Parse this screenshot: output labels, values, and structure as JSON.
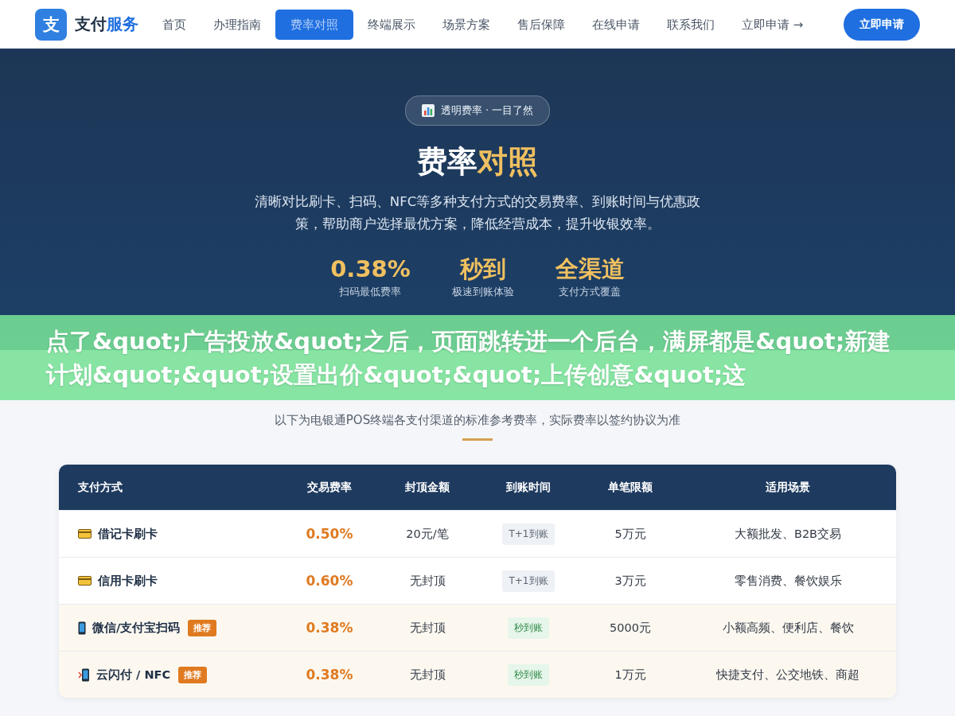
{
  "header": {
    "logo_mark": "支",
    "brand_main": "支付",
    "brand_accent": "服务",
    "nav": [
      {
        "label": "首页",
        "selected": false
      },
      {
        "label": "办理指南",
        "selected": false
      },
      {
        "label": "费率对照",
        "selected": true
      },
      {
        "label": "终端展示",
        "selected": false
      },
      {
        "label": "场景方案",
        "selected": false
      },
      {
        "label": "售后保障",
        "selected": false
      },
      {
        "label": "在线申请",
        "selected": false
      },
      {
        "label": "联系我们",
        "selected": false
      },
      {
        "label": "立即申请 →",
        "selected": false
      }
    ],
    "cta": "立即申请"
  },
  "hero": {
    "badge": "透明费率 · 一目了然",
    "title_main": "费率",
    "title_accent": "对照",
    "description": "清晰对比刷卡、扫码、NFC等多种支付方式的交易费率、到账时间与优惠政策，帮助商户选择最优方案，降低经营成本，提升收银效率。",
    "stats": [
      {
        "value": "0.38%",
        "label": "扫码最低费率"
      },
      {
        "value": "秒到",
        "label": "极速到账体验"
      },
      {
        "value": "全渠道",
        "label": "支付方式覆盖"
      }
    ]
  },
  "overlay_banner": "点了&quot;广告投放&quot;之后，页面跳转进一个后台，满屏都是&quot;新建计划&quot;&quot;设置出价&quot;&quot;上传创意&quot;这",
  "section": {
    "subtitle": "以下为电银通POS终端各支付渠道的标准参考费率，实际费率以签约协议为准"
  },
  "table": {
    "columns": [
      "支付方式",
      "交易费率",
      "封顶金额",
      "到账时间",
      "单笔限额",
      "适用场景"
    ],
    "rows": [
      {
        "kind": "card",
        "method": "借记卡刷卡",
        "recommended": false,
        "rate": "0.50%",
        "cap": "20元/笔",
        "settle": {
          "text": "T+1到账",
          "kind": "pending"
        },
        "limit": "5万元",
        "scene": "大额批发、B2B交易"
      },
      {
        "kind": "card",
        "method": "信用卡刷卡",
        "recommended": false,
        "rate": "0.60%",
        "cap": "无封顶",
        "settle": {
          "text": "T+1到账",
          "kind": "pending"
        },
        "limit": "3万元",
        "scene": "零售消费、餐饮娱乐"
      },
      {
        "kind": "phone",
        "method": "微信/支付宝扫码",
        "recommended": true,
        "badge": "推荐",
        "rate": "0.38%",
        "cap": "无封顶",
        "settle": {
          "text": "秒到账",
          "kind": "instant"
        },
        "limit": "5000元",
        "scene": "小额高频、便利店、餐饮"
      },
      {
        "kind": "nfc",
        "method": "云闪付 / NFC",
        "recommended": true,
        "badge": "推荐",
        "rate": "0.38%",
        "cap": "无封顶",
        "settle": {
          "text": "秒到账",
          "kind": "instant"
        },
        "limit": "1万元",
        "scene": "快捷支付、公交地铁、商超"
      }
    ]
  }
}
